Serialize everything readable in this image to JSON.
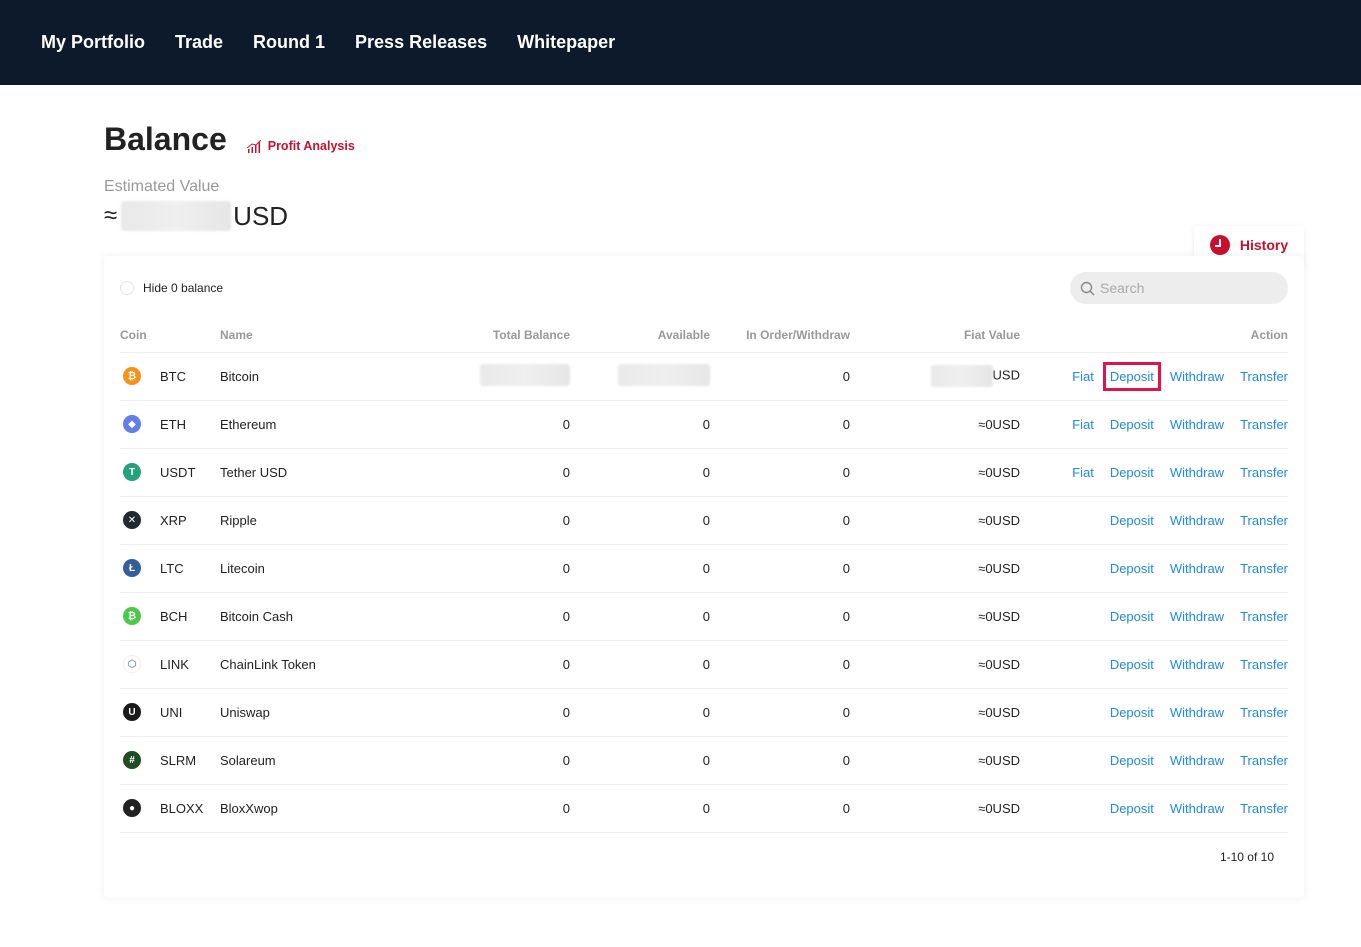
{
  "nav": {
    "items": [
      "My Portfolio",
      "Trade",
      "Round 1",
      "Press Releases",
      "Whitepaper"
    ]
  },
  "header": {
    "title": "Balance",
    "profit_link": "Profit Analysis",
    "estimated_label": "Estimated Value",
    "approx_symbol": "≈",
    "currency": "USD",
    "history_label": "History"
  },
  "toolbar": {
    "hide_zero_label": "Hide 0 balance",
    "search_placeholder": "Search"
  },
  "table": {
    "headers": {
      "coin": "Coin",
      "name": "Name",
      "total": "Total Balance",
      "available": "Available",
      "in_order": "In Order/Withdraw",
      "fiat": "Fiat Value",
      "action": "Action"
    },
    "action_labels": {
      "fiat": "Fiat",
      "deposit": "Deposit",
      "withdraw": "Withdraw",
      "transfer": "Transfer"
    },
    "rows": [
      {
        "symbol": "BTC",
        "name": "Bitcoin",
        "total": "",
        "available": "",
        "in_order": "0",
        "fiat": "USD",
        "has_fiat": true,
        "icon": "bitcoin-icon",
        "color": "#f7931a",
        "glyph": "₿"
      },
      {
        "symbol": "ETH",
        "name": "Ethereum",
        "total": "0",
        "available": "0",
        "in_order": "0",
        "fiat": "≈0USD",
        "has_fiat": true,
        "icon": "ethereum-icon",
        "color": "#627eea",
        "glyph": "◆"
      },
      {
        "symbol": "USDT",
        "name": "Tether USD",
        "total": "0",
        "available": "0",
        "in_order": "0",
        "fiat": "≈0USD",
        "has_fiat": true,
        "icon": "tether-icon",
        "color": "#26a17b",
        "glyph": "T"
      },
      {
        "symbol": "XRP",
        "name": "Ripple",
        "total": "0",
        "available": "0",
        "in_order": "0",
        "fiat": "≈0USD",
        "has_fiat": false,
        "icon": "ripple-icon",
        "color": "#23292f",
        "glyph": "✕"
      },
      {
        "symbol": "LTC",
        "name": "Litecoin",
        "total": "0",
        "available": "0",
        "in_order": "0",
        "fiat": "≈0USD",
        "has_fiat": false,
        "icon": "litecoin-icon",
        "color": "#345d9d",
        "glyph": "Ł"
      },
      {
        "symbol": "BCH",
        "name": "Bitcoin Cash",
        "total": "0",
        "available": "0",
        "in_order": "0",
        "fiat": "≈0USD",
        "has_fiat": false,
        "icon": "bitcoin-cash-icon",
        "color": "#4cc94c",
        "glyph": "₿"
      },
      {
        "symbol": "LINK",
        "name": "ChainLink Token",
        "total": "0",
        "available": "0",
        "in_order": "0",
        "fiat": "≈0USD",
        "has_fiat": false,
        "icon": "chainlink-icon",
        "color": "#ffffff",
        "glyph": "⬡"
      },
      {
        "symbol": "UNI",
        "name": "Uniswap",
        "total": "0",
        "available": "0",
        "in_order": "0",
        "fiat": "≈0USD",
        "has_fiat": false,
        "icon": "uniswap-icon",
        "color": "#1a1a1a",
        "glyph": "U"
      },
      {
        "symbol": "SLRM",
        "name": "Solareum",
        "total": "0",
        "available": "0",
        "in_order": "0",
        "fiat": "≈0USD",
        "has_fiat": false,
        "icon": "solareum-icon",
        "color": "#1f4d1f",
        "glyph": "#"
      },
      {
        "symbol": "BLOXX",
        "name": "BloxXwop",
        "total": "0",
        "available": "0",
        "in_order": "0",
        "fiat": "≈0USD",
        "has_fiat": false,
        "icon": "bloxxwop-icon",
        "color": "#222222",
        "glyph": "●"
      }
    ],
    "highlighted_row": 0,
    "highlighted_action": "deposit"
  },
  "pagination": {
    "label": "1-10 of 10"
  },
  "colors": {
    "nav_bg": "#0c1a2b",
    "accent_red": "#c8102e",
    "link_blue": "#1e88e5",
    "highlight": "#e0144c"
  }
}
